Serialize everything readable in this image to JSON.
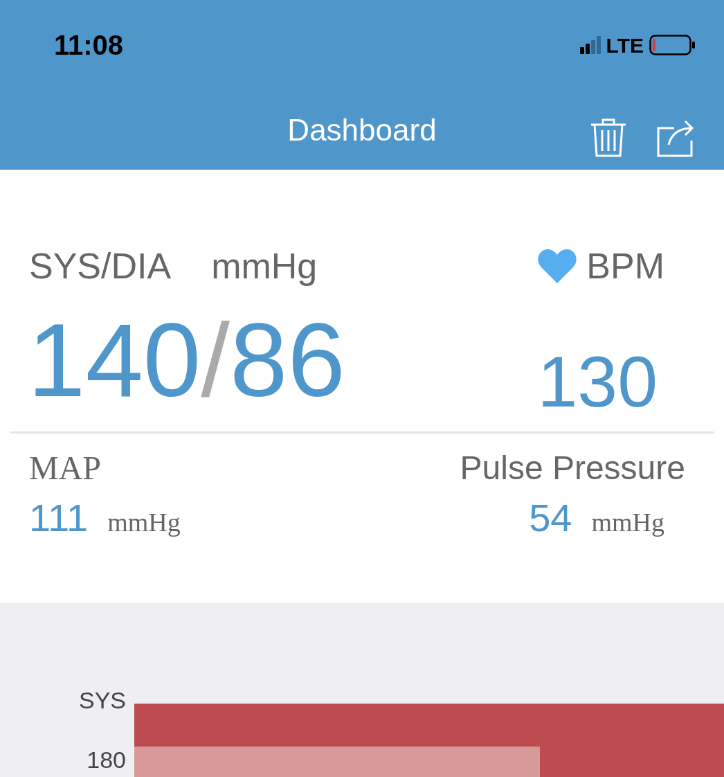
{
  "status_bar": {
    "time": "11:08",
    "network": "LTE"
  },
  "header": {
    "title": "Dashboard"
  },
  "reading": {
    "bp_label": "SYS/DIA",
    "bp_unit": "mmHg",
    "pulse_label": "BPM",
    "sys": "140",
    "separator": "/",
    "dia": "86",
    "pulse": "130"
  },
  "derived": [
    {
      "label": "MAP",
      "value": "111",
      "unit": "mmHg"
    },
    {
      "label": "Pulse Pressure",
      "value": "54",
      "unit": "mmHg"
    }
  ],
  "chart": {
    "axis_title": "SYS",
    "tick": "180"
  }
}
